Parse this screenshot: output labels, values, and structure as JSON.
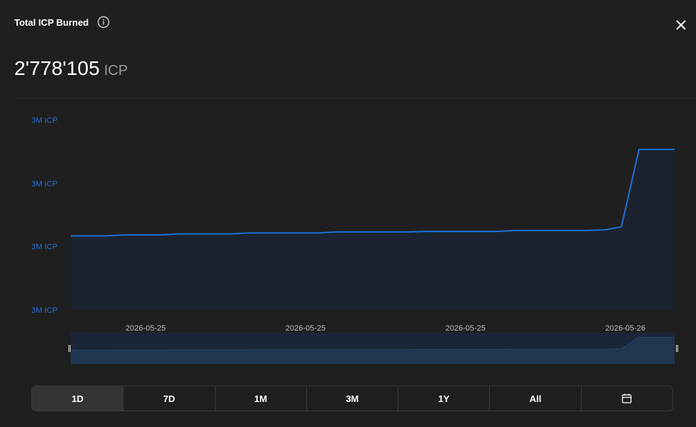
{
  "header": {
    "title": "Total ICP Burned"
  },
  "summary": {
    "value": "2'778'105",
    "unit": "ICP"
  },
  "colors": {
    "accent": "#1f6fd6",
    "background": "#1f1f1f",
    "area_fill": "#1b2330",
    "active_button": "#343434"
  },
  "icons": {
    "info": "info-icon",
    "close": "close-icon",
    "calendar": "calendar-icon"
  },
  "range_buttons": [
    {
      "label": "1D",
      "active": true
    },
    {
      "label": "7D",
      "active": false
    },
    {
      "label": "1M",
      "active": false
    },
    {
      "label": "3M",
      "active": false
    },
    {
      "label": "1Y",
      "active": false
    },
    {
      "label": "All",
      "active": false
    }
  ],
  "chart_data": {
    "type": "area",
    "title": "",
    "xlabel": "",
    "ylabel": "",
    "ytick_labels": [
      "3M ICP",
      "3M ICP",
      "3M ICP",
      "3M ICP"
    ],
    "xtick_labels": [
      "2026-05-25",
      "2026-05-25",
      "2026-05-25",
      "2026-05-26"
    ],
    "grid": false,
    "legend": "none",
    "ylim": [
      2776500,
      2778400
    ],
    "series": [
      {
        "values": [
          2777240,
          2777240,
          2777240,
          2777250,
          2777250,
          2777250,
          2777260,
          2777260,
          2777260,
          2777260,
          2777270,
          2777270,
          2777270,
          2777270,
          2777270,
          2777280,
          2777280,
          2777280,
          2777280,
          2777280,
          2777285,
          2777285,
          2777285,
          2777285,
          2777285,
          2777295,
          2777295,
          2777295,
          2777295,
          2777295,
          2777300,
          2777330,
          2778105,
          2778105,
          2778105
        ]
      }
    ],
    "navigator": {
      "show": true
    }
  }
}
